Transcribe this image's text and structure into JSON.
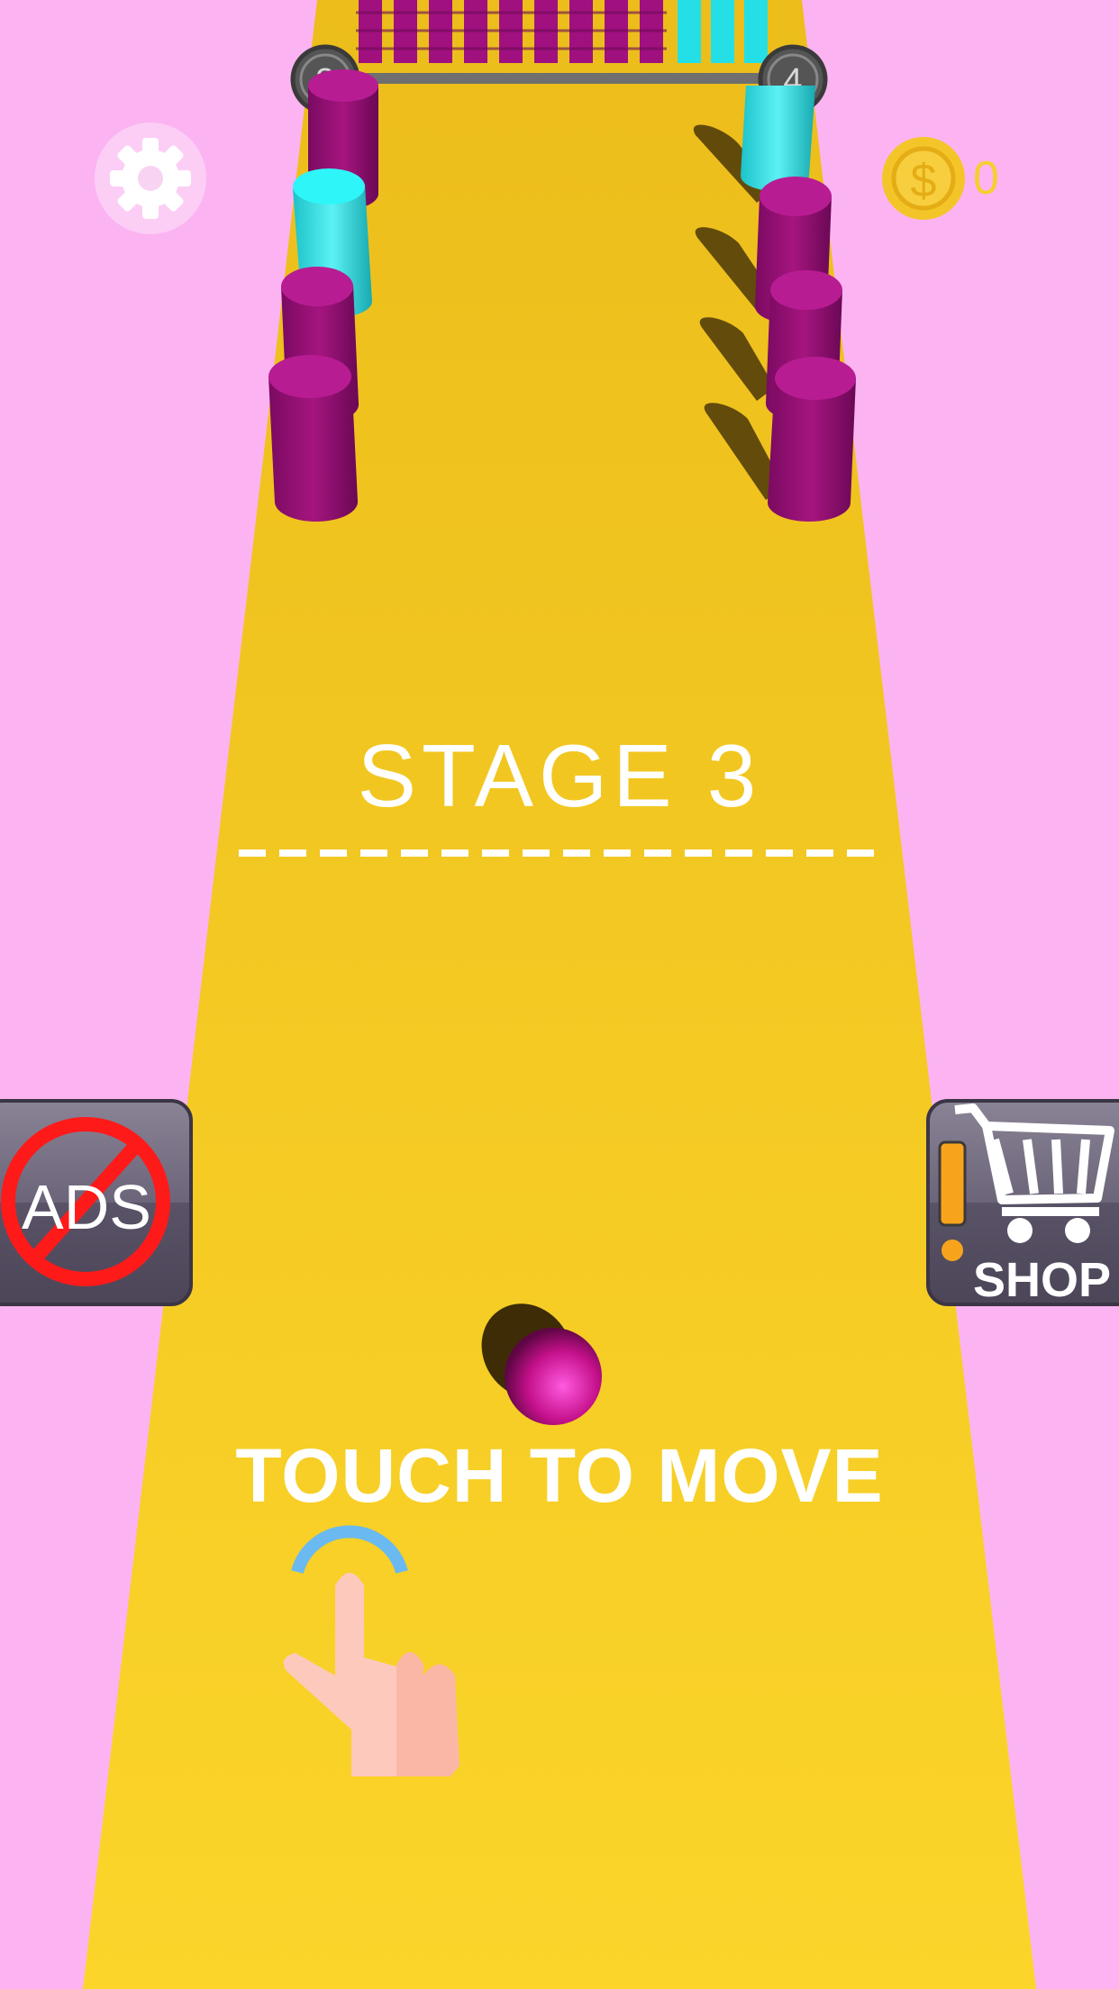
{
  "game": {
    "stage_label": "STAGE 3",
    "instruction": "TOUCH TO MOVE",
    "coins": "0",
    "progress": {
      "current_level": "3",
      "next_level": "4",
      "fraction": 0.0
    },
    "ads_button_label": "ADS",
    "shop_button_label": "SHOP"
  },
  "colors": {
    "background": "#fbb4f1",
    "track": "#f3c21f",
    "obstacle_magenta": "#a0107f",
    "obstacle_cyan": "#1fe0e6",
    "ball": "#d4148f",
    "button_bg": "#5b5468"
  },
  "icons": {
    "settings": "gear-icon",
    "coin": "dollar-coin-icon",
    "no_ads": "no-ads-icon",
    "shop": "shopping-cart-icon",
    "tap_hint": "pointing-hand-icon"
  }
}
